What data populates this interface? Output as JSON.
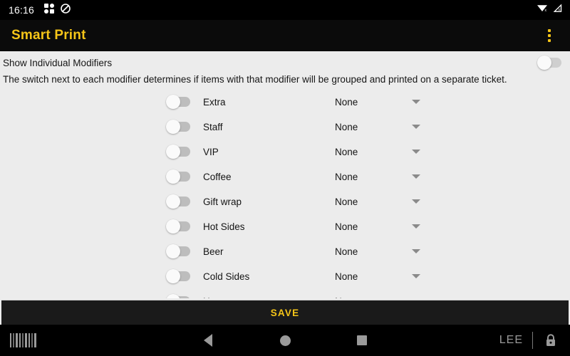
{
  "statusbar": {
    "time": "16:16",
    "left_icons": [
      "apps-grid-icon",
      "do-not-disturb-icon"
    ],
    "right_icons": [
      "wifi-no-internet-icon",
      "cellular-no-signal-icon"
    ]
  },
  "appbar": {
    "title": "Smart Print",
    "overflow_icon": "more-vertical-icon",
    "accent_color": "#f5c518",
    "background_color": "#0b0b0b"
  },
  "header": {
    "title": "Show Individual Modifiers",
    "master_switch_on": false,
    "description": "The switch next to each modifier determines if items with that modifier will be grouped and printed on a separate ticket."
  },
  "modifiers": [
    {
      "label": "Extra",
      "enabled": false,
      "value": "None"
    },
    {
      "label": "Staff",
      "enabled": false,
      "value": "None"
    },
    {
      "label": "VIP",
      "enabled": false,
      "value": "None"
    },
    {
      "label": "Coffee",
      "enabled": false,
      "value": "None"
    },
    {
      "label": "Gift wrap",
      "enabled": false,
      "value": "None"
    },
    {
      "label": "Hot Sides",
      "enabled": false,
      "value": "None"
    },
    {
      "label": "Beer",
      "enabled": false,
      "value": "None"
    },
    {
      "label": "Cold Sides",
      "enabled": false,
      "value": "None"
    },
    {
      "label": "Hot",
      "enabled": false,
      "value": "None"
    }
  ],
  "save": {
    "label": "SAVE"
  },
  "navbar": {
    "barcode_icon": "barcode-icon",
    "back_icon": "back-triangle-icon",
    "home_icon": "home-circle-icon",
    "recents_icon": "recents-square-icon",
    "user": "LEE",
    "lock_icon": "lock-icon"
  }
}
